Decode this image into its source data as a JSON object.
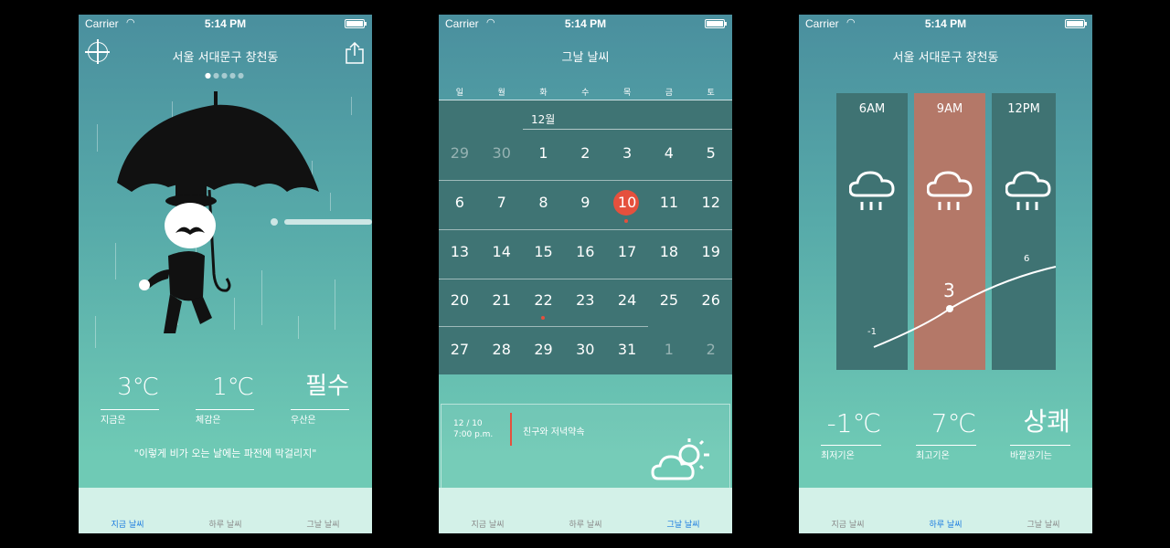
{
  "status": {
    "carrier": "Carrier",
    "time": "5:14 PM"
  },
  "screen_now": {
    "location": "서울 서대문구 창천동",
    "page_count": 5,
    "current_page": 1,
    "stats": [
      {
        "value": "3℃",
        "label": "지금은"
      },
      {
        "value": "1℃",
        "label": "체감은"
      },
      {
        "value": "필수",
        "label": "우산은"
      }
    ],
    "quote": "\"이렇게 비가 오는 날에는 파전에 막걸리지\""
  },
  "screen_calendar": {
    "title": "그날 날씨",
    "weekdays": [
      "일",
      "월",
      "화",
      "수",
      "목",
      "금",
      "토"
    ],
    "month": "12월",
    "weeks": [
      [
        "29",
        "30",
        "1",
        "2",
        "3",
        "4",
        "5"
      ],
      [
        "6",
        "7",
        "8",
        "9",
        "10",
        "11",
        "12"
      ],
      [
        "13",
        "14",
        "15",
        "16",
        "17",
        "18",
        "19"
      ],
      [
        "20",
        "21",
        "22",
        "23",
        "24",
        "25",
        "26"
      ],
      [
        "27",
        "28",
        "29",
        "30",
        "31",
        "1",
        "2"
      ]
    ],
    "selected_day": "10",
    "event": {
      "date": "12 / 10",
      "time": "7:00 p.m.",
      "title": "친구와 저녁약속"
    }
  },
  "screen_hourly": {
    "location": "서울 서대문구 창천동",
    "hours": [
      "6AM",
      "9AM",
      "12PM"
    ],
    "highlighted_hour": "9AM",
    "temps": [
      "-1",
      "3",
      "6"
    ],
    "stats": [
      {
        "value": "-1℃",
        "label": "최저기온"
      },
      {
        "value": "7℃",
        "label": "최고기온"
      },
      {
        "value": "상쾌",
        "label": "바깥공기는"
      }
    ]
  },
  "tabs": [
    "지금 날씨",
    "하루 날씨",
    "그날 날씨"
  ],
  "active_tabs": [
    0,
    1,
    2
  ],
  "colors": {
    "accent": "#e5503d",
    "tab_active": "#1a7be0",
    "highlight_column": "#b47868"
  }
}
